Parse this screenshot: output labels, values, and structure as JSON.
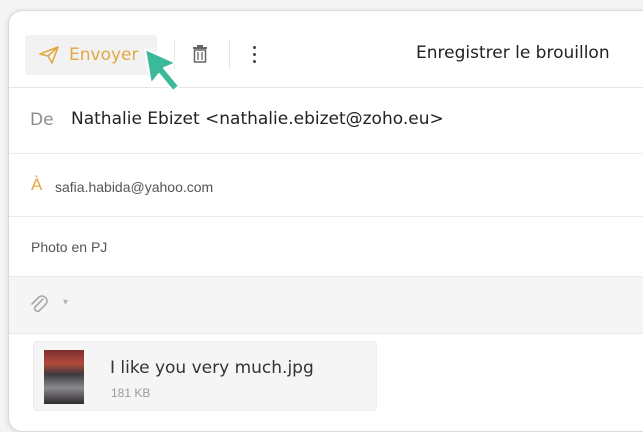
{
  "toolbar": {
    "send_label": "Envoyer",
    "save_draft_label": "Enregistrer le brouillon",
    "icons": {
      "send": "paper-plane-icon",
      "delete": "trash-icon",
      "more": "more-vertical-icon"
    }
  },
  "fields": {
    "from_label": "De",
    "from_value": "Nathalie Ebizet <nathalie.ebizet@zoho.eu>",
    "to_label": "À",
    "to_value": "safia.habida@yahoo.com",
    "subject_value": "Photo en PJ"
  },
  "attachment": {
    "name": "I like you very much.jpg",
    "size": "181 KB"
  },
  "colors": {
    "accent": "#e3a843",
    "cursor": "#3cb89a"
  }
}
